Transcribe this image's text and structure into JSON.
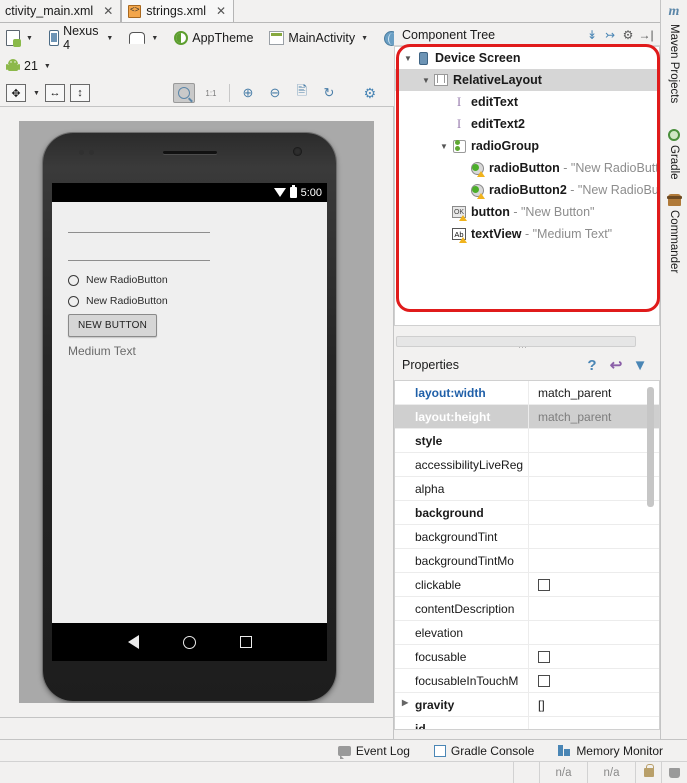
{
  "tabs": [
    {
      "label": "ctivity_main.xml",
      "icon": "xml-file-icon",
      "active": true,
      "closable": true
    },
    {
      "label": "strings.xml",
      "icon": "xml-file-icon",
      "active": false,
      "closable": true
    }
  ],
  "toolbar": {
    "device_file_icon": "device-file-icon",
    "device": "Nexus 4",
    "orientation_icon": "orientation-icon",
    "theme": "AppTheme",
    "activity": "MainActivity",
    "locale_icon": "globe-icon",
    "api_level": "21"
  },
  "zoom_toolbar": {
    "fit_icon": "fit-to-screen-icon",
    "width_icon": "fit-width-icon",
    "height_icon": "fit-height-icon",
    "pan_icon": "pan-icon",
    "actual_size_label": "1:1",
    "zoom_in_icon": "zoom-in-icon",
    "zoom_out_icon": "zoom-out-icon",
    "file_icon": "document-icon",
    "refresh_icon": "refresh-icon",
    "settings_icon": "gear-icon"
  },
  "preview": {
    "status_time": "5:00",
    "wifi_icon": "wifi-icon",
    "battery_icon": "battery-icon",
    "radio1": "New RadioButton",
    "radio2": "New RadioButton",
    "button": "NEW BUTTON",
    "textview": "Medium Text",
    "nav_back_icon": "back-triangle-icon",
    "nav_home_icon": "home-circle-icon",
    "nav_recents_icon": "recents-square-icon"
  },
  "component_tree": {
    "title": "Component Tree",
    "actions": [
      {
        "name": "expand-all-icon"
      },
      {
        "name": "collapse-all-icon"
      },
      {
        "name": "gear-icon"
      },
      {
        "name": "hide-panel-icon"
      }
    ],
    "nodes": [
      {
        "indent": 0,
        "twisty": "▼",
        "icon": "device-screen-icon",
        "name": "Device Screen",
        "value": "",
        "selected": false,
        "warn": false
      },
      {
        "indent": 1,
        "twisty": "▼",
        "icon": "relative-layout-icon",
        "name": "RelativeLayout",
        "value": "",
        "selected": true,
        "warn": false
      },
      {
        "indent": 2,
        "twisty": "",
        "icon": "edit-text-icon",
        "name": "editText",
        "value": "",
        "selected": false,
        "warn": false
      },
      {
        "indent": 2,
        "twisty": "",
        "icon": "edit-text-icon",
        "name": "editText2",
        "value": "",
        "selected": false,
        "warn": false
      },
      {
        "indent": 2,
        "twisty": "▼",
        "icon": "radio-group-icon",
        "name": "radioGroup",
        "value": "",
        "selected": false,
        "warn": false
      },
      {
        "indent": 3,
        "twisty": "",
        "icon": "radio-button-icon",
        "name": "radioButton",
        "value": "- \"New RadioButt",
        "selected": false,
        "warn": true
      },
      {
        "indent": 3,
        "twisty": "",
        "icon": "radio-button-icon",
        "name": "radioButton2",
        "value": "- \"New RadioBu",
        "selected": false,
        "warn": true
      },
      {
        "indent": 2,
        "twisty": "",
        "icon": "button-icon",
        "name": "button",
        "value": "- \"New Button\"",
        "selected": false,
        "warn": true
      },
      {
        "indent": 2,
        "twisty": "",
        "icon": "text-view-icon",
        "name": "textView",
        "value": "- \"Medium Text\"",
        "selected": false,
        "warn": true
      }
    ]
  },
  "properties": {
    "title": "Properties",
    "actions": [
      {
        "name": "help-icon",
        "glyph": "?"
      },
      {
        "name": "restore-default-icon",
        "glyph": "↩"
      },
      {
        "name": "filter-icon",
        "glyph": "▼"
      }
    ],
    "rows": [
      {
        "key": "layout:width",
        "value": "match_parent",
        "style": "hl",
        "checkbox": false,
        "expander": false
      },
      {
        "key": "layout:height",
        "value": "match_parent",
        "style": "selrow",
        "checkbox": false,
        "expander": false
      },
      {
        "key": "style",
        "value": "",
        "style": "bold",
        "checkbox": false,
        "expander": false
      },
      {
        "key": "accessibilityLiveReg",
        "value": "",
        "style": "",
        "checkbox": false,
        "expander": false
      },
      {
        "key": "alpha",
        "value": "",
        "style": "",
        "checkbox": false,
        "expander": false
      },
      {
        "key": "background",
        "value": "",
        "style": "bold",
        "checkbox": false,
        "expander": false
      },
      {
        "key": "backgroundTint",
        "value": "",
        "style": "",
        "checkbox": false,
        "expander": false
      },
      {
        "key": "backgroundTintMo",
        "value": "",
        "style": "",
        "checkbox": false,
        "expander": false
      },
      {
        "key": "clickable",
        "value": "",
        "style": "",
        "checkbox": true,
        "expander": false
      },
      {
        "key": "contentDescription",
        "value": "",
        "style": "",
        "checkbox": false,
        "expander": false
      },
      {
        "key": "elevation",
        "value": "",
        "style": "",
        "checkbox": false,
        "expander": false
      },
      {
        "key": "focusable",
        "value": "",
        "style": "",
        "checkbox": true,
        "expander": false
      },
      {
        "key": "focusableInTouchM",
        "value": "",
        "style": "",
        "checkbox": true,
        "expander": false
      },
      {
        "key": "gravity",
        "value": "[]",
        "style": "bold",
        "checkbox": false,
        "expander": true
      },
      {
        "key": "id",
        "value": "",
        "style": "bold",
        "checkbox": false,
        "expander": false
      }
    ]
  },
  "right_sidebar": [
    {
      "label": "Maven Projects",
      "icon": "maven-icon"
    },
    {
      "label": "Gradle",
      "icon": "gradle-icon"
    },
    {
      "label": "Commander",
      "icon": "commander-icon"
    }
  ],
  "status_bar": [
    {
      "label": "Event Log",
      "icon": "event-log-icon"
    },
    {
      "label": "Gradle Console",
      "icon": "gradle-console-icon"
    },
    {
      "label": "Memory Monitor",
      "icon": "memory-monitor-icon"
    }
  ],
  "bottom_cells": [
    {
      "label": "n/a"
    },
    {
      "label": "n/a"
    }
  ],
  "bottom_icons": [
    {
      "name": "lock-icon"
    },
    {
      "name": "trash-icon"
    }
  ]
}
